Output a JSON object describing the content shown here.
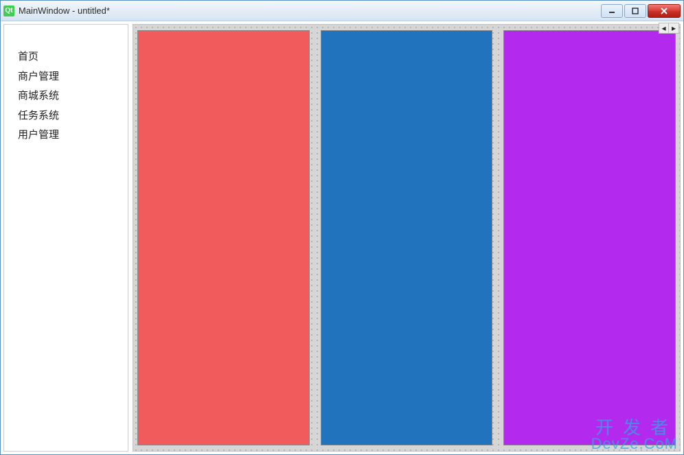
{
  "window": {
    "title": "MainWindow - untitled*",
    "app_icon_label": "Qt"
  },
  "sidebar": {
    "items": [
      {
        "label": "首页"
      },
      {
        "label": "商户管理"
      },
      {
        "label": "商城系统"
      },
      {
        "label": "任务系统"
      },
      {
        "label": "用户管理"
      }
    ]
  },
  "panels": {
    "colors": {
      "panel1": "#f25b5b",
      "panel2": "#2273bd",
      "panel3": "#b329ed"
    }
  },
  "watermark": {
    "line1": "开发者",
    "line2": "DevZe.CoM"
  }
}
